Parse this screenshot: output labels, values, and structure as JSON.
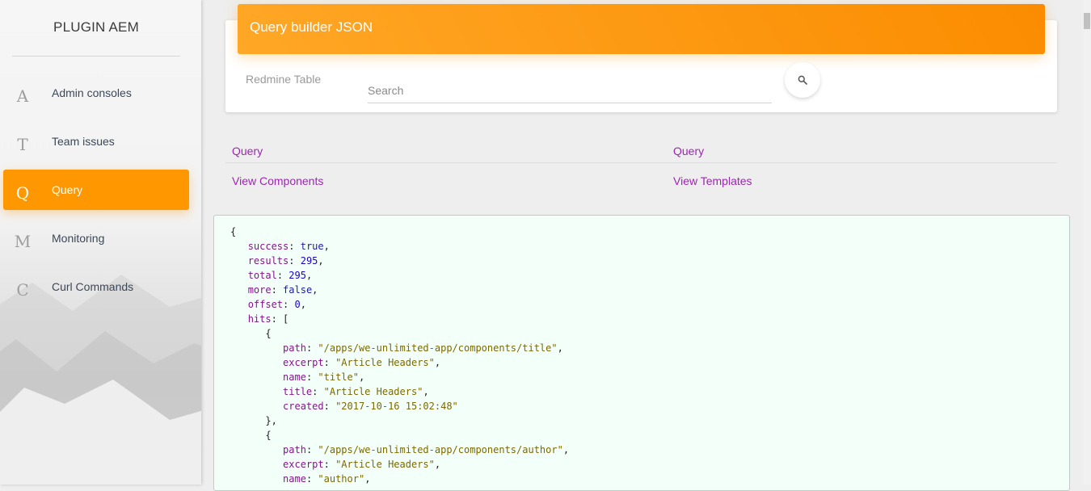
{
  "sidebar": {
    "brand": "PLUGIN AEM",
    "items": [
      {
        "letter": "A",
        "label": "Admin consoles",
        "active": false
      },
      {
        "letter": "T",
        "label": "Team issues",
        "active": false
      },
      {
        "letter": "Q",
        "label": "Query",
        "active": true
      },
      {
        "letter": "M",
        "label": "Monitoring",
        "active": false
      },
      {
        "letter": "C",
        "label": "Curl Commands",
        "active": false
      }
    ]
  },
  "card": {
    "title": "Query builder JSON",
    "table_label": "Redmine Table",
    "search_placeholder": "Search",
    "search_icon": "search-icon"
  },
  "links": {
    "row1": [
      "Query",
      "Query"
    ],
    "row2": [
      "View Components",
      "View Templates"
    ]
  },
  "colors": {
    "accent": "#ff9800",
    "link": "#9c27b0",
    "json_background": "#f3fff9"
  },
  "json_lines": [
    [
      {
        "t": "{"
      }
    ],
    [
      {
        "t": "   "
      },
      {
        "t": "success",
        "c": "k"
      },
      {
        "t": ": "
      },
      {
        "t": "true",
        "c": "b"
      },
      {
        "t": ","
      }
    ],
    [
      {
        "t": "   "
      },
      {
        "t": "results",
        "c": "k"
      },
      {
        "t": ": "
      },
      {
        "t": "295",
        "c": "n"
      },
      {
        "t": ","
      }
    ],
    [
      {
        "t": "   "
      },
      {
        "t": "total",
        "c": "k"
      },
      {
        "t": ": "
      },
      {
        "t": "295",
        "c": "n"
      },
      {
        "t": ","
      }
    ],
    [
      {
        "t": "   "
      },
      {
        "t": "more",
        "c": "k"
      },
      {
        "t": ": "
      },
      {
        "t": "false",
        "c": "b"
      },
      {
        "t": ","
      }
    ],
    [
      {
        "t": "   "
      },
      {
        "t": "offset",
        "c": "k"
      },
      {
        "t": ": "
      },
      {
        "t": "0",
        "c": "n"
      },
      {
        "t": ","
      }
    ],
    [
      {
        "t": "   "
      },
      {
        "t": "hits",
        "c": "k"
      },
      {
        "t": ": ["
      }
    ],
    [
      {
        "t": "      {"
      }
    ],
    [
      {
        "t": "         "
      },
      {
        "t": "path",
        "c": "k"
      },
      {
        "t": ": "
      },
      {
        "t": "\"/apps/we-unlimited-app/components/title\"",
        "c": "s"
      },
      {
        "t": ","
      }
    ],
    [
      {
        "t": "         "
      },
      {
        "t": "excerpt",
        "c": "k"
      },
      {
        "t": ": "
      },
      {
        "t": "\"Article Headers\"",
        "c": "s"
      },
      {
        "t": ","
      }
    ],
    [
      {
        "t": "         "
      },
      {
        "t": "name",
        "c": "k"
      },
      {
        "t": ": "
      },
      {
        "t": "\"title\"",
        "c": "s"
      },
      {
        "t": ","
      }
    ],
    [
      {
        "t": "         "
      },
      {
        "t": "title",
        "c": "k"
      },
      {
        "t": ": "
      },
      {
        "t": "\"Article Headers\"",
        "c": "s"
      },
      {
        "t": ","
      }
    ],
    [
      {
        "t": "         "
      },
      {
        "t": "created",
        "c": "k"
      },
      {
        "t": ": "
      },
      {
        "t": "\"2017-10-16 15:02:48\"",
        "c": "s"
      }
    ],
    [
      {
        "t": "      },"
      }
    ],
    [
      {
        "t": "      {"
      }
    ],
    [
      {
        "t": "         "
      },
      {
        "t": "path",
        "c": "k"
      },
      {
        "t": ": "
      },
      {
        "t": "\"/apps/we-unlimited-app/components/author\"",
        "c": "s"
      },
      {
        "t": ","
      }
    ],
    [
      {
        "t": "         "
      },
      {
        "t": "excerpt",
        "c": "k"
      },
      {
        "t": ": "
      },
      {
        "t": "\"Article Headers\"",
        "c": "s"
      },
      {
        "t": ","
      }
    ],
    [
      {
        "t": "         "
      },
      {
        "t": "name",
        "c": "k"
      },
      {
        "t": ": "
      },
      {
        "t": "\"author\"",
        "c": "s"
      },
      {
        "t": ","
      }
    ]
  ]
}
